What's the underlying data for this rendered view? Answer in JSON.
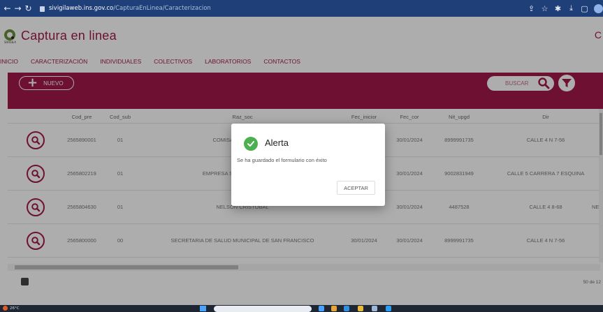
{
  "browser": {
    "url_domain": "sivigilaweb.ins.gov.co",
    "url_path": "/CapturaEnLinea/Caracterizacion"
  },
  "app": {
    "title": "Captura en linea",
    "logo_text": "SIVIGILA",
    "corner_mark": "C"
  },
  "menu": {
    "items": [
      "INICIO",
      "CARACTERIZACIÓN",
      "INDIVIDUALES",
      "COLECTIVOS",
      "LABORATORIOS",
      "CONTACTOS"
    ]
  },
  "toolbar": {
    "new_label": "NUEVO",
    "search_placeholder": "BUSCAR"
  },
  "table": {
    "columns": [
      "Cod_pre",
      "Cod_sub",
      "Raz_soc",
      "Fec_inicior",
      "Fec_cor",
      "Nit_upgd",
      "Dir"
    ],
    "rows": [
      {
        "cod_pre": "2565890001",
        "cod_sub": "01",
        "raz_soc": "COMISARIA DE FAMILIA",
        "fec_ini": "",
        "fec_cor": "30/01/2024",
        "nit": "8999991735",
        "dir": "CALLE 4 N 7-56"
      },
      {
        "cod_pre": "2565802219",
        "cod_sub": "01",
        "raz_soc": "EMPRESA SOCIAL DEL ESTADO",
        "fec_ini": "",
        "fec_cor": "30/01/2024",
        "nit": "9002831949",
        "dir": "CALLE 5 CARRERA 7 ESQUINA"
      },
      {
        "cod_pre": "2565804630",
        "cod_sub": "01",
        "raz_soc": "NELSON CRISTOBAL",
        "fec_ini": "",
        "fec_cor": "30/01/2024",
        "nit": "4487528",
        "dir": "CALLE 4 8-68"
      },
      {
        "cod_pre": "2565800000",
        "cod_sub": "00",
        "raz_soc": "SECRETARIA DE SALUD MUNICIPAL DE SAN FRANCISCO",
        "fec_ini": "30/01/2024",
        "fec_cor": "30/01/2024",
        "nit": "8999991735",
        "dir": "CALLE 4 N 7-56"
      }
    ],
    "overflow_cell": "NE"
  },
  "pager": {
    "text": "50 de 12"
  },
  "dialog": {
    "title": "Alerta",
    "message": "Se ha guardado el formulario con éxito",
    "accept_label": "ACEPTAR"
  },
  "taskbar": {
    "weather": "26°C"
  },
  "colors": {
    "brand": "#a3194b",
    "success": "#4caf50",
    "chrome": "#1f3f78"
  }
}
